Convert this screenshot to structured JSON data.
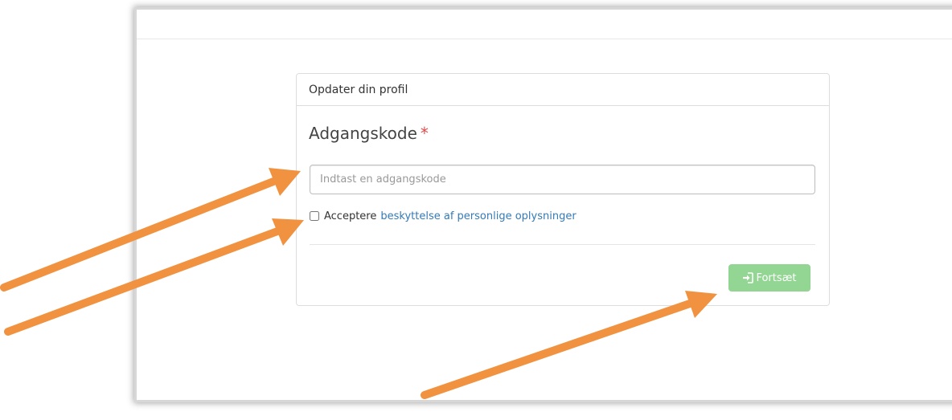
{
  "panel": {
    "heading": "Opdater din profil"
  },
  "password": {
    "label": "Adgangskode",
    "required_marker": "*",
    "placeholder": "Indtast en adgangskode",
    "value": ""
  },
  "consent": {
    "checked": false,
    "prefix": "Acceptere",
    "link_text": "beskyttelse af personlige oplysninger"
  },
  "actions": {
    "continue_label": "Fortsæt",
    "continue_icon": "sign-in-icon",
    "continue_color": "#93d593"
  },
  "annotations": {
    "arrow_color": "#f0923f"
  }
}
